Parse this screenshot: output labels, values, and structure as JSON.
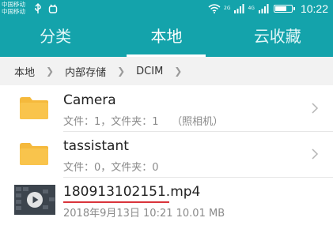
{
  "status_bar": {
    "carrier_top": "中国移动",
    "carrier_bottom": "中国移动",
    "time": "10:22",
    "net_4g": "4G",
    "net_2g": "2G",
    "battery_level_pct": 70,
    "colors": {
      "background": "#14a3ab"
    }
  },
  "tabs": [
    {
      "label": "分类",
      "active": false
    },
    {
      "label": "本地",
      "active": true
    },
    {
      "label": "云收藏",
      "active": false
    }
  ],
  "breadcrumb": [
    "本地",
    "内部存储",
    "DCIM"
  ],
  "files": [
    {
      "name": "Camera",
      "meta": "文件：1，文件夹：1    （照相机）",
      "type": "folder",
      "icon": "folder-icon"
    },
    {
      "name": "tassistant",
      "meta": "文件：0，文件夹：0",
      "type": "folder",
      "icon": "folder-icon"
    },
    {
      "name": "180913102151.mp4",
      "meta": "2018年9月13日 10:21 10.01 MB",
      "type": "video",
      "icon": "video-thumbnail"
    }
  ],
  "colors": {
    "accent": "#14a3ab",
    "folder": "#f5b93c",
    "highlight_underline": "#d9343a"
  }
}
